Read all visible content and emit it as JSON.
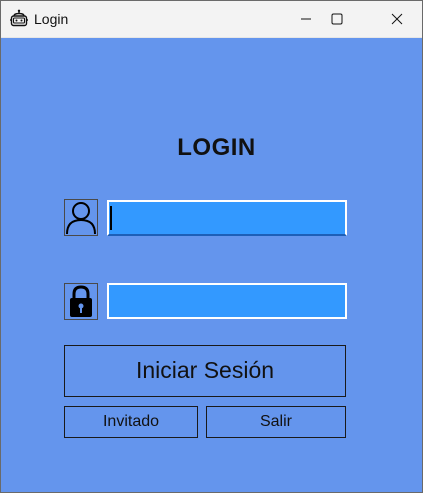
{
  "window": {
    "title": "Login",
    "icon": "app-robot-icon",
    "controls": [
      "minimize-icon",
      "maximize-icon",
      "close-icon"
    ]
  },
  "form": {
    "heading": "LOGIN",
    "username": {
      "icon": "user-icon",
      "value": "",
      "placeholder": ""
    },
    "password": {
      "icon": "lock-icon",
      "value": "",
      "placeholder": ""
    }
  },
  "buttons": {
    "login_label": "Iniciar Sesión",
    "guest_label": "Invitado",
    "exit_label": "Salir"
  },
  "colors": {
    "background": "#6495ed",
    "input_fill": "#3399ff",
    "titlebar": "#f3f3f3"
  }
}
